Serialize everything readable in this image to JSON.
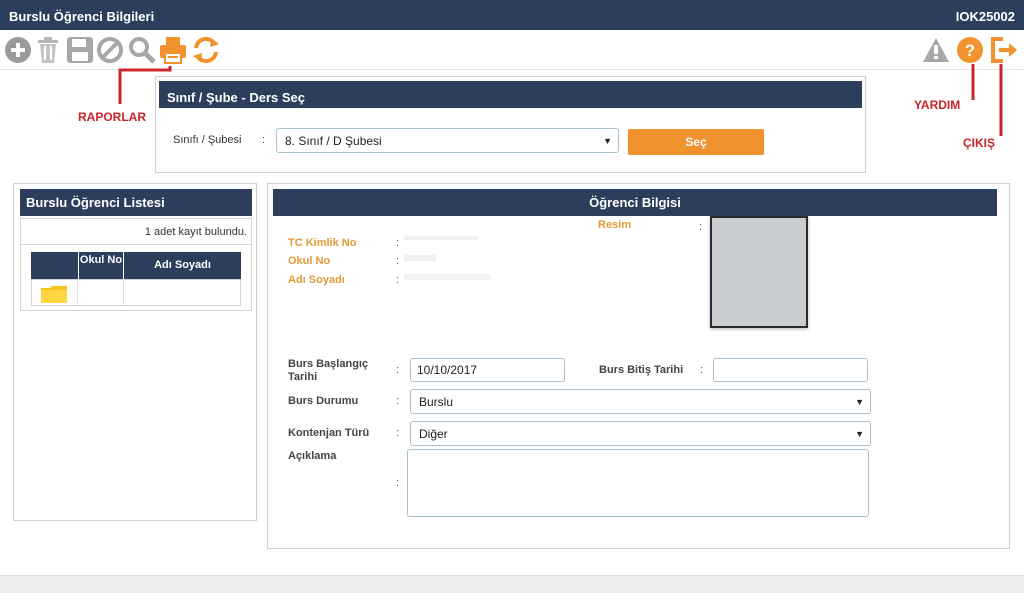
{
  "window": {
    "title": "Burslu Öğrenci Bilgileri",
    "code": "IOK25002"
  },
  "toolbar": {
    "icons": [
      "add-icon",
      "delete-icon",
      "save-icon",
      "cancel-icon",
      "search-icon",
      "print-icon",
      "refresh-icon",
      "warning-icon",
      "help-icon",
      "exit-icon"
    ]
  },
  "annotations": {
    "raporlar": "RAPORLAR",
    "yardim": "YARDIM",
    "cikis": "ÇIKIŞ"
  },
  "class_select": {
    "header": "Sınıf / Şube  - Ders Seç",
    "label": "Sınıfı / Şubesi",
    "colon": ":",
    "value": "8. Sınıf / D Şubesi",
    "button": "Seç"
  },
  "student_list": {
    "header": "Burslu Öğrenci Listesi",
    "count_text": "1 adet kayıt bulundu.",
    "columns": [
      "",
      "Okul No",
      "Adı Soyadı"
    ]
  },
  "student_info": {
    "header": "Öğrenci Bilgisi",
    "tc_label": "TC Kimlik No",
    "okul_label": "Okul No",
    "ad_label": "Adı Soyadı",
    "resim_label": "Resim",
    "colon": ":",
    "start_label": "Burs Başlangıç Tarihi",
    "start_value": "10/10/2017",
    "end_label": "Burs Bitiş Tarihi",
    "end_value": "",
    "status_label": "Burs Durumu",
    "status_value": "Burslu",
    "quota_label": "Kontenjan Türü",
    "quota_value": "Diğer",
    "note_label": "Açıklama",
    "note_value": ""
  },
  "colors": {
    "navy": "#2c3e5c",
    "orange": "#f0922e",
    "annotation_red": "#c9242a"
  }
}
